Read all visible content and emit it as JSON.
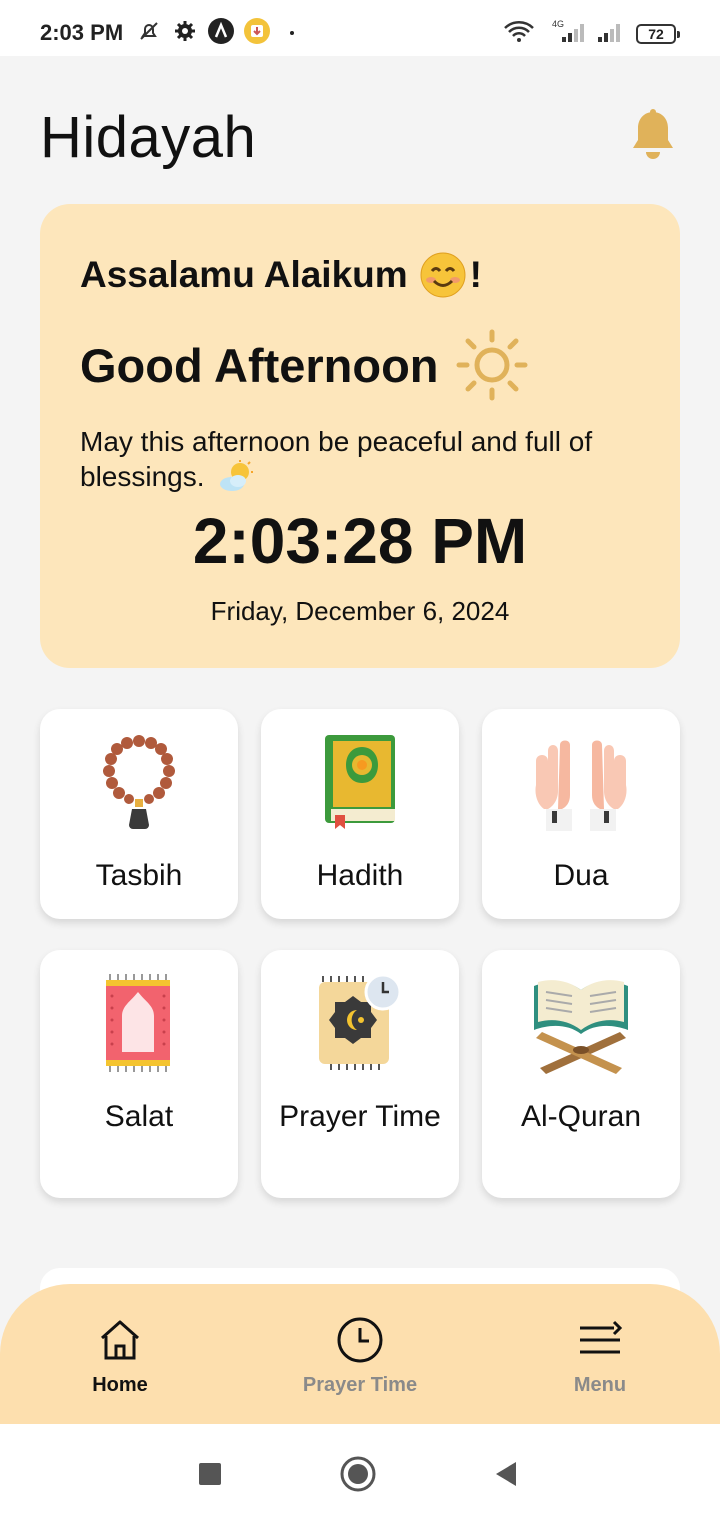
{
  "status_bar": {
    "time": "2:03 PM",
    "battery": "72",
    "network": "4G",
    "icons": [
      "mute-bell-icon",
      "settings-gear-icon",
      "app-a-icon",
      "download-notif-icon",
      "wifi-icon",
      "signal-icon"
    ]
  },
  "header": {
    "title": "Hidayah",
    "notification_icon": "bell-icon"
  },
  "greeting": {
    "salam": "Assalamu Alaikum",
    "salam_suffix": "!",
    "salam_emoji": "smiling-face-icon",
    "period": "Good Afternoon",
    "period_icon": "sun-icon",
    "message": "May this afternoon be peaceful and full of blessings.",
    "message_emoji": "sun-behind-cloud-icon",
    "time": "2:03:28 PM",
    "date": "Friday, December 6, 2024"
  },
  "features": [
    {
      "label": "Tasbih",
      "icon": "prayer-beads-icon"
    },
    {
      "label": "Hadith",
      "icon": "book-icon"
    },
    {
      "label": "Dua",
      "icon": "praying-hands-icon"
    },
    {
      "label": "Salat",
      "icon": "prayer-mat-icon"
    },
    {
      "label": "Prayer Time",
      "icon": "prayer-clock-icon"
    },
    {
      "label": "Al-Quran",
      "icon": "open-quran-icon"
    }
  ],
  "bottom_nav": {
    "items": [
      {
        "label": "Home",
        "icon": "home-icon",
        "active": true
      },
      {
        "label": "Prayer Time",
        "icon": "clock-icon",
        "active": false
      },
      {
        "label": "Menu",
        "icon": "menu-icon",
        "active": false
      }
    ]
  },
  "colors": {
    "card_bg": "#fde6bb",
    "nav_bg": "#fddfae",
    "accent": "#e0b25a",
    "inactive": "#8a8a8a"
  }
}
